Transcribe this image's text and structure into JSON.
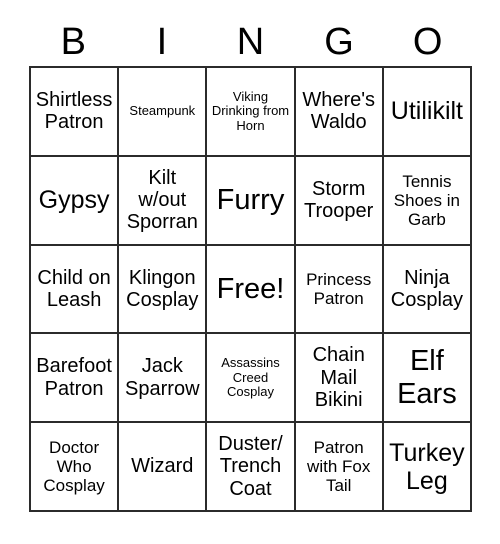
{
  "card": {
    "title_letters": [
      "B",
      "I",
      "N",
      "G",
      "O"
    ],
    "grid": {
      "rows": 5,
      "columns": 5,
      "line_color": "#2b2b2b",
      "background": "#ffffff",
      "text_color": "#000000"
    },
    "cells": [
      {
        "text": "Shirtless Patron",
        "size": "md",
        "free": false
      },
      {
        "text": "Steampunk",
        "size": "xs",
        "free": false
      },
      {
        "text": "Viking Drinking from Horn",
        "size": "xs",
        "free": false
      },
      {
        "text": "Where's Waldo",
        "size": "md",
        "free": false
      },
      {
        "text": "Utilikilt",
        "size": "lg",
        "free": false
      },
      {
        "text": "Gypsy",
        "size": "lg",
        "free": false
      },
      {
        "text": "Kilt w/out Sporran",
        "size": "md",
        "free": false
      },
      {
        "text": "Furry",
        "size": "xl",
        "free": false
      },
      {
        "text": "Storm Trooper",
        "size": "md",
        "free": false
      },
      {
        "text": "Tennis Shoes in Garb",
        "size": "sm",
        "free": false
      },
      {
        "text": "Child on Leash",
        "size": "md",
        "free": false
      },
      {
        "text": "Klingon Cosplay",
        "size": "md",
        "free": false
      },
      {
        "text": "Free!",
        "size": "xl",
        "free": true
      },
      {
        "text": "Princess Patron",
        "size": "sm",
        "free": false
      },
      {
        "text": "Ninja Cosplay",
        "size": "md",
        "free": false
      },
      {
        "text": "Barefoot Patron",
        "size": "md",
        "free": false
      },
      {
        "text": "Jack Sparrow",
        "size": "md",
        "free": false
      },
      {
        "text": "Assassins Creed Cosplay",
        "size": "xs",
        "free": false
      },
      {
        "text": "Chain Mail Bikini",
        "size": "md",
        "free": false
      },
      {
        "text": "Elf Ears",
        "size": "xl",
        "free": false
      },
      {
        "text": "Doctor Who Cosplay",
        "size": "sm",
        "free": false
      },
      {
        "text": "Wizard",
        "size": "md",
        "free": false
      },
      {
        "text": "Duster/ Trench Coat",
        "size": "md",
        "free": false
      },
      {
        "text": "Patron with Fox Tail",
        "size": "sm",
        "free": false
      },
      {
        "text": "Turkey Leg",
        "size": "lg",
        "free": false
      }
    ]
  }
}
